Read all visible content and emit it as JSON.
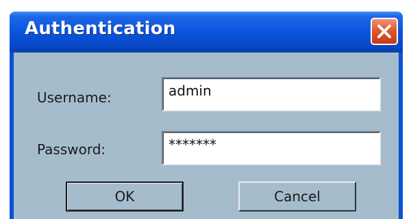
{
  "window": {
    "title": "Authentication",
    "colors": {
      "titlebar": "#0a55dc",
      "body": "#a5bccd",
      "close": "#e2582c"
    }
  },
  "form": {
    "username_label": "Username:",
    "username_value": "admin",
    "password_label": "Password:",
    "password_value": "*******"
  },
  "buttons": {
    "ok_label": "OK",
    "cancel_label": "Cancel"
  },
  "icons": {
    "close": "close-icon"
  }
}
